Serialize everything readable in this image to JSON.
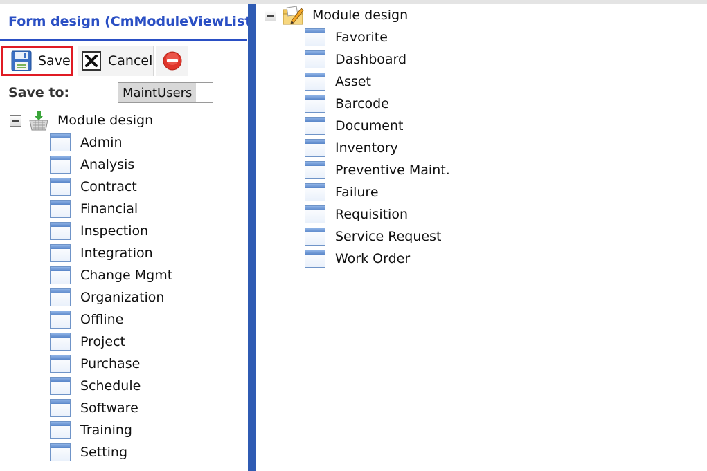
{
  "left_panel": {
    "title": "Form design (CmModuleViewList)",
    "toolbar": {
      "save_label": "Save",
      "cancel_label": "Cancel"
    },
    "save_to": {
      "label": "Save to:",
      "value": "MaintUsers"
    },
    "tree": {
      "root_label": "Module design",
      "items": [
        "Admin",
        "Analysis",
        "Contract",
        "Financial",
        "Inspection",
        "Integration",
        "Change Mgmt",
        "Organization",
        "Offline",
        "Project",
        "Purchase",
        "Schedule",
        "Software",
        "Training",
        "Setting"
      ]
    }
  },
  "right_panel": {
    "tree": {
      "root_label": "Module design",
      "items": [
        "Favorite",
        "Dashboard",
        "Asset",
        "Barcode",
        "Document",
        "Inventory",
        "Preventive Maint.",
        "Failure",
        "Requisition",
        "Service Request",
        "Work Order"
      ]
    }
  },
  "icons": {
    "save": "floppy-disk-icon",
    "cancel": "cancel-x-icon",
    "delete": "delete-circle-icon",
    "left_root": "basket-download-icon",
    "right_root": "folder-pencil-icon",
    "tree_item": "form-window-icon",
    "expander": "collapse-minus-icon"
  },
  "colors": {
    "title_blue": "#2a4fc4",
    "divider_blue": "#2f5bb3",
    "save_highlight": "#e01b24",
    "delete_red": "#e0352b"
  }
}
